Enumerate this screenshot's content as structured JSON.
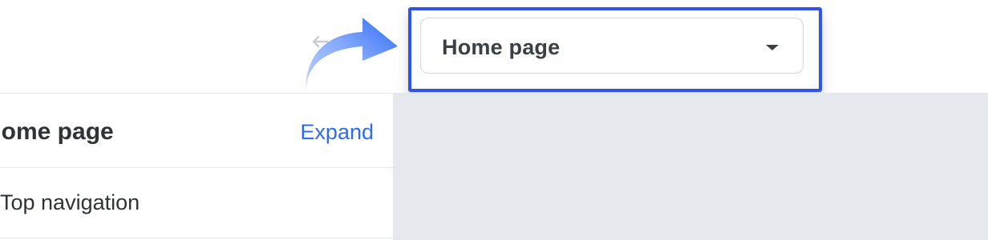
{
  "toolbar": {
    "undo_icon": "undo-icon",
    "page_select": {
      "value": "Home page",
      "icon": "chevron-down-icon"
    },
    "highlight_color": "#2f54eb",
    "callout_arrow_color": "#2f6bf0"
  },
  "left_panel": {
    "title": "Home page",
    "expand_label": "Expand",
    "sections": [
      {
        "label": "Top navigation"
      }
    ]
  },
  "canvas": {
    "background": "#e5e8ed"
  }
}
